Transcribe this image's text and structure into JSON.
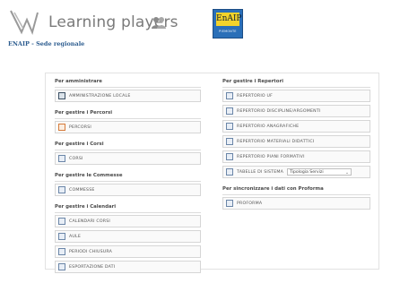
{
  "header": {
    "title": "Learning players",
    "subtitle": "ENAIP - Sede regionale",
    "badge": {
      "text": "EnAIP",
      "subtext": "PIEMONTE",
      "color": "#2a6fb8",
      "accent": "#f3d32b"
    }
  },
  "left": {
    "sections": [
      {
        "title": "Per amministrare",
        "items": [
          {
            "label": "AMMINISTRAZIONE LOCALE",
            "icon": "admin-icon"
          }
        ]
      },
      {
        "title": "Per gestire i Percorsi",
        "items": [
          {
            "label": "PERCORSI",
            "icon": "percorsi-icon"
          }
        ]
      },
      {
        "title": "Per gestire i Corsi",
        "items": [
          {
            "label": "CORSI",
            "icon": "corsi-icon"
          }
        ]
      },
      {
        "title": "Per gestire le Commesse",
        "items": [
          {
            "label": "COMMESSE",
            "icon": "commesse-icon"
          }
        ]
      },
      {
        "title": "Per gestire i Calendari",
        "items": [
          {
            "label": "CALENDARI CORSI",
            "icon": "calendar-icon"
          },
          {
            "label": "AULE",
            "icon": "calendar-icon"
          },
          {
            "label": "PERIODI CHIUSURA",
            "icon": "calendar-icon"
          },
          {
            "label": "ESPORTAZIONE DATI",
            "icon": "calendar-icon"
          }
        ]
      }
    ]
  },
  "right": {
    "sections": [
      {
        "title": "Per gestire i Repertori",
        "items": [
          {
            "label": "REPERTORIO UF",
            "icon": "document-icon"
          },
          {
            "label": "REPERTORIO DISCIPLINE/ARGOMENTI",
            "icon": "document-icon"
          },
          {
            "label": "REPERTORIO ANAGRAFICHE",
            "icon": "contacts-icon"
          },
          {
            "label": "REPERTORIO MATERIALI DIDATTICI",
            "icon": "document-icon"
          },
          {
            "label": "REPERTORIO PIANI FORMATIVI",
            "icon": "document-icon"
          },
          {
            "label": "TABELLE DI SISTEMA",
            "icon": "table-icon",
            "select": "Tipologia Servizi"
          }
        ]
      },
      {
        "title": "Per sincronizzare i dati con Proforma",
        "items": [
          {
            "label": "PROFORMA",
            "icon": "sync-icon"
          }
        ]
      }
    ]
  }
}
